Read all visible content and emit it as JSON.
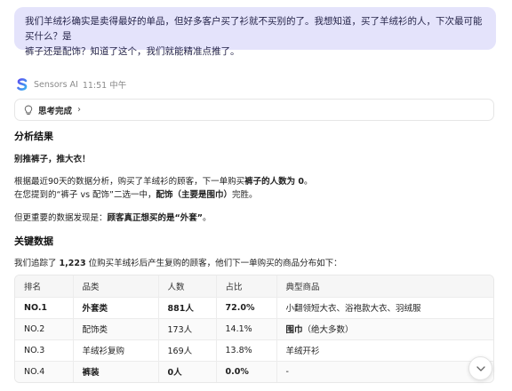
{
  "user_message": {
    "line1": "我们羊绒衫确实是卖得最好的单品，但好多客户买了衫就不买别的了。我想知道，买了羊绒衫的人，下次最可能买什么？是",
    "line2": "裤子还是配饰？知道了这个，我们就能精准点推了。"
  },
  "bot": {
    "name": "Sensors AI",
    "time": "11:51 中午"
  },
  "thinking": {
    "label": "思考完成",
    "chevron": "›"
  },
  "answer": {
    "heading": "分析结果",
    "headline": "别推裤子，推大衣！",
    "p1_a": "根据最近90天的数据分析，购买了羊绒衫的顾客，下一单购买",
    "p1_b": "裤子的人数为 0",
    "p1_c": "。",
    "p2_a": "在您提到的“裤子 vs 配饰”二选一中，",
    "p2_b": "配饰（主要是围巾）",
    "p2_c": "完胜。",
    "p3_a": "但更重要的数据发现是：",
    "p3_b": "顾客真正想买的是“外套”",
    "p3_c": "。",
    "key_heading": "关键数据",
    "p4_a": "我们追踪了 ",
    "p4_b": "1,223",
    "p4_c": " 位购买羊绒衫后产生复购的顾客，他们下一单购买的商品分布如下："
  },
  "table": {
    "headers": [
      "排名",
      "品类",
      "人数",
      "占比",
      "典型商品"
    ],
    "rows": [
      {
        "rank": "NO.1",
        "category": "外套类",
        "count": "881人",
        "pct": "72.0%",
        "items": "小翻领短大衣、浴袍款大衣、羽绒服"
      },
      {
        "rank": "NO.2",
        "category": "配饰类",
        "count": "173人",
        "pct": "14.1%",
        "items_bold": "围巾",
        "items_rest": "（绝大多数）"
      },
      {
        "rank": "NO.3",
        "category": "羊绒衫复购",
        "count": "169人",
        "pct": "13.8%",
        "items": "羊绒开衫"
      },
      {
        "rank": "NO.4",
        "category": "裤装",
        "count": "0人",
        "pct": "0.0%",
        "items": "-"
      }
    ]
  },
  "icons": {
    "logo": "sensors-ai-logo-icon",
    "thinking": "lightbulb-icon",
    "scroll": "chevron-down-icon"
  },
  "colors": {
    "user_bubble": "#e4e3fb",
    "logo_gradient_start": "#5b4ef0",
    "logo_gradient_end": "#3ab0f0"
  }
}
